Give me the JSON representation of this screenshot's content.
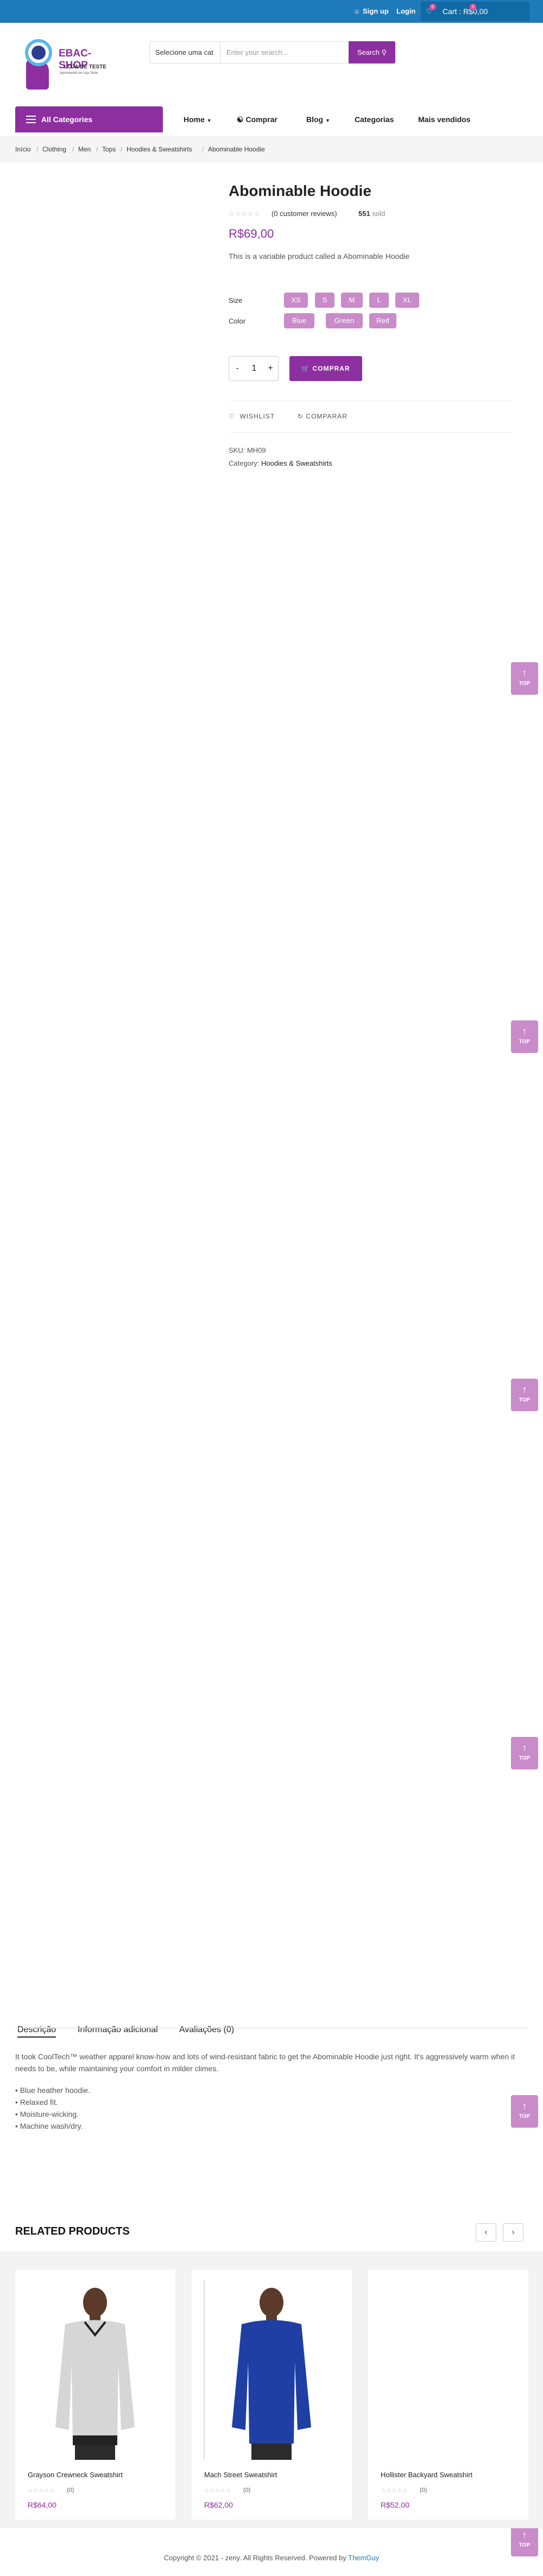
{
  "topbar": {
    "signup": "Sign up",
    "login": "Login",
    "wishlist_count": "0",
    "cart_count": "0",
    "cart_label": "Cart : R$0,00"
  },
  "header": {
    "logo_name": "EBAC-SHOP",
    "logo_sub": "LOJA DE TESTE",
    "logo_sub2": "Aprendendo de Loja Teste",
    "search_category": "Selecione uma cat",
    "search_placeholder": "Enter your search...",
    "search_button": "Search"
  },
  "nav": {
    "all_categories": "All Categories",
    "items": [
      "Home",
      "Comprar",
      "Blog",
      "Categorias",
      "Mais vendidos"
    ]
  },
  "breadcrumb": [
    "Início",
    "Clothing",
    "Men",
    "Tops",
    "Hoodies & Sweatshirts",
    "Abominable Hoodie"
  ],
  "product": {
    "title": "Abominable Hoodie",
    "reviews": "(0 customer reviews)",
    "sold_count": "551",
    "sold_label": "sold",
    "price": "R$69,00",
    "description": "This is a variable product called a Abominable Hoodie",
    "size_label": "Size",
    "sizes": [
      "XS",
      "S",
      "M",
      "L",
      "XL"
    ],
    "color_label": "Color",
    "colors": [
      "Blue",
      "Green",
      "Red"
    ],
    "qty_minus": "-",
    "qty": "1",
    "qty_plus": "+",
    "buy_label": "COMPRAR",
    "wishlist": "WISHLIST",
    "compare": "COMPARAR",
    "sku_label": "SKU:",
    "sku": "MH09",
    "category_label": "Category:",
    "category": "Hoodies & Sweatshirts"
  },
  "top_button": "TOP",
  "tabs": {
    "items": [
      "Descrição",
      "Informação adicional",
      "Avaliações (0)"
    ],
    "paragraph_line1": "It took CoolTech™ weather apparel know-how and lots of wind-resistant fabric to get the Abominable Hoodie just right. It's aggressively warm when it",
    "paragraph_line2": "needs to be, while maintaining your comfort in milder climes.",
    "bullets": [
      "• Blue heather hoodie.",
      "• Relaxed fit.",
      "• Moisture-wicking.",
      "• Machine wash/dry."
    ]
  },
  "related": {
    "heading": "RELATED PRODUCTS",
    "products": [
      {
        "name": "Grayson Crewneck Sweatshirt",
        "count": "(0)",
        "price": "R$64,00"
      },
      {
        "name": "Mach Street Sweatshirt",
        "count": "(0)",
        "price": "R$62,00"
      },
      {
        "name": "Hollister Backyard Sweatshirt",
        "count": "(0)",
        "price": "R$52,00"
      }
    ]
  },
  "footer": {
    "text": "Copyright © 2021 - zeny. All Rights Reserved. Powered by ",
    "brand": "ThemGuy"
  },
  "colors": {
    "primary": "#8d2fa0",
    "chip": "#c98bc9",
    "topbar": "#1e7ab8"
  }
}
